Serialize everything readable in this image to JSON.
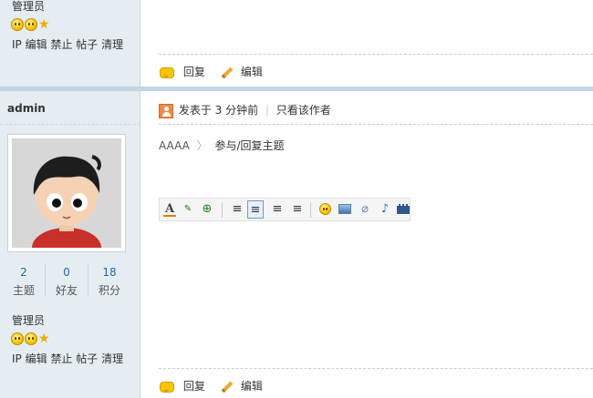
{
  "post1": {
    "role": "管理员",
    "actions": [
      "IP",
      "编辑",
      "禁止",
      "帖子",
      "清理"
    ],
    "reply_label": "回复",
    "edit_label": "编辑"
  },
  "post2": {
    "username": "admin",
    "posted": "发表于 3 分钟前",
    "only_author": "只看该作者",
    "stats": [
      {
        "value": "2",
        "label": "主题"
      },
      {
        "value": "0",
        "label": "好友"
      },
      {
        "value": "18",
        "label": "积分"
      }
    ],
    "role": "管理员",
    "actions": [
      "IP",
      "编辑",
      "禁止",
      "帖子",
      "清理"
    ],
    "breadcrumb": {
      "root": "AAAA",
      "sep": "〉",
      "current": "参与/回复主题"
    },
    "reply_label": "回复",
    "edit_label": "编辑"
  },
  "editor_toolbar": [
    "font-color-icon",
    "spellcheck-icon",
    "add-link-icon",
    "align-justify-icon",
    "align-left-icon",
    "align-center-icon",
    "align-right-icon",
    "smiley-icon",
    "image-icon",
    "attachment-icon",
    "music-icon",
    "video-icon"
  ]
}
